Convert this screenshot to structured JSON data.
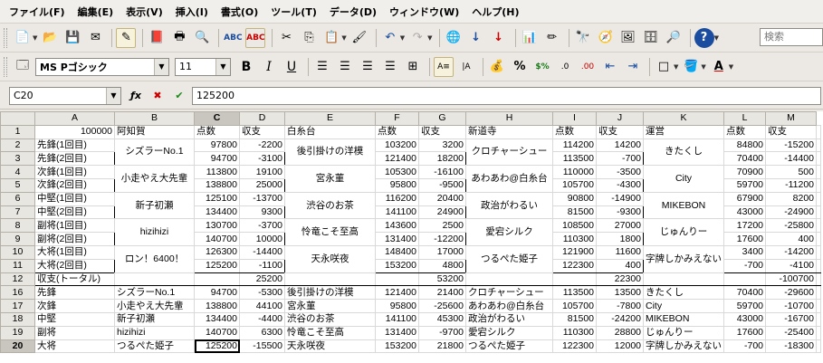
{
  "menu": [
    "ファイル(F)",
    "編集(E)",
    "表示(V)",
    "挿入(I)",
    "書式(O)",
    "ツール(T)",
    "データ(D)",
    "ウィンドウ(W)",
    "ヘルプ(H)"
  ],
  "toolbar": {
    "font_name": "MS Pゴシック",
    "font_size": "11",
    "search_placeholder": "検索"
  },
  "formula_bar": {
    "cell_ref": "C20",
    "value": "125200"
  },
  "columns": [
    "A",
    "B",
    "C",
    "D",
    "E",
    "F",
    "G",
    "H",
    "I",
    "J",
    "K",
    "L",
    "M"
  ],
  "selected_column": "C",
  "selected_row": "20",
  "rows": [
    {
      "n": "1",
      "cells": [
        "100000",
        "阿知賀",
        "点数",
        "収支",
        "白糸台",
        "点数",
        "収支",
        "新道寺",
        "点数",
        "収支",
        "運営",
        "点数",
        "収支"
      ]
    },
    {
      "n": "2",
      "cells": [
        "先鋒(1回目)",
        "",
        "97800",
        "-2200",
        "",
        "103200",
        "3200",
        "",
        "114200",
        "14200",
        "",
        "84800",
        "-15200"
      ]
    },
    {
      "n": "3",
      "cells": [
        "先鋒(2回目)",
        "",
        "94700",
        "-3100",
        "",
        "121400",
        "18200",
        "",
        "113500",
        "-700",
        "",
        "70400",
        "-14400"
      ]
    },
    {
      "n": "4",
      "cells": [
        "次鋒(1回目)",
        "",
        "113800",
        "19100",
        "",
        "105300",
        "-16100",
        "",
        "110000",
        "-3500",
        "",
        "70900",
        "500"
      ]
    },
    {
      "n": "5",
      "cells": [
        "次鋒(2回目)",
        "",
        "138800",
        "25000",
        "",
        "95800",
        "-9500",
        "",
        "105700",
        "-4300",
        "",
        "59700",
        "-11200"
      ]
    },
    {
      "n": "6",
      "cells": [
        "中堅(1回目)",
        "",
        "125100",
        "-13700",
        "",
        "116200",
        "20400",
        "",
        "90800",
        "-14900",
        "",
        "67900",
        "8200"
      ]
    },
    {
      "n": "7",
      "cells": [
        "中堅(2回目)",
        "",
        "134400",
        "9300",
        "",
        "141100",
        "24900",
        "",
        "81500",
        "-9300",
        "",
        "43000",
        "-24900"
      ]
    },
    {
      "n": "8",
      "cells": [
        "副将(1回目)",
        "",
        "130700",
        "-3700",
        "",
        "143600",
        "2500",
        "",
        "108500",
        "27000",
        "",
        "17200",
        "-25800"
      ]
    },
    {
      "n": "9",
      "cells": [
        "副将(2回目)",
        "",
        "140700",
        "10000",
        "",
        "131400",
        "-12200",
        "",
        "110300",
        "1800",
        "",
        "17600",
        "400"
      ]
    },
    {
      "n": "10",
      "cells": [
        "大将(1回目)",
        "",
        "126300",
        "-14400",
        "",
        "148400",
        "17000",
        "",
        "121900",
        "11600",
        "",
        "3400",
        "-14200"
      ]
    },
    {
      "n": "11",
      "cells": [
        "大将(2回目)",
        "",
        "125200",
        "-1100",
        "",
        "153200",
        "4800",
        "",
        "122300",
        "400",
        "",
        "-700",
        "-4100"
      ]
    },
    {
      "n": "12",
      "cells": [
        "収支(トータル)",
        "",
        "",
        "25200",
        "",
        "",
        "53200",
        "",
        "",
        "22300",
        "",
        "",
        "-100700"
      ]
    },
    {
      "n": "16",
      "cells": [
        "先鋒",
        "シズラーNo.1",
        "94700",
        "-5300",
        "後引掛けの洋模",
        "121400",
        "21400",
        "クロチャーシュー",
        "113500",
        "13500",
        "きたくし",
        "70400",
        "-29600"
      ]
    },
    {
      "n": "17",
      "cells": [
        "次鋒",
        "小走やえ大先輩",
        "138800",
        "44100",
        "宮永菫",
        "95800",
        "-25600",
        "あわあわ@白糸台",
        "105700",
        "-7800",
        "City",
        "59700",
        "-10700"
      ]
    },
    {
      "n": "18",
      "cells": [
        "中堅",
        "新子初瀬",
        "134400",
        "-4400",
        "渋谷のお茶",
        "141100",
        "45300",
        "政治がわるい",
        "81500",
        "-24200",
        "MIKEBON",
        "43000",
        "-16700"
      ]
    },
    {
      "n": "19",
      "cells": [
        "副将",
        "hizihizi",
        "140700",
        "6300",
        "怜竜こそ至高",
        "131400",
        "-9700",
        "愛宕シルク",
        "110300",
        "28800",
        "じゅんりー",
        "17600",
        "-25400"
      ]
    },
    {
      "n": "20",
      "cells": [
        "大将",
        "つるぺた姫子",
        "125200",
        "-15500",
        "天永咲夜",
        "153200",
        "21800",
        "つるぺた姫子",
        "122300",
        "12000",
        "字牌しかみえない",
        "-700",
        "-18300"
      ]
    }
  ],
  "merged_names": {
    "B": [
      "シズラーNo.1",
      "小走やえ大先輩",
      "新子初瀬",
      "hizihizi",
      "ロン！6400！"
    ],
    "E": [
      "後引掛けの洋模",
      "宮永菫",
      "渋谷のお茶",
      "怜竜こそ至高",
      "天永咲夜"
    ],
    "H": [
      "クロチャーシュー",
      "あわあわ@白糸台",
      "政治がわるい",
      "愛宕シルク",
      "つるぺた姫子"
    ],
    "K": [
      "きたくし",
      "City",
      "MIKEBON",
      "じゅんりー",
      "字牌しかみえない"
    ]
  }
}
